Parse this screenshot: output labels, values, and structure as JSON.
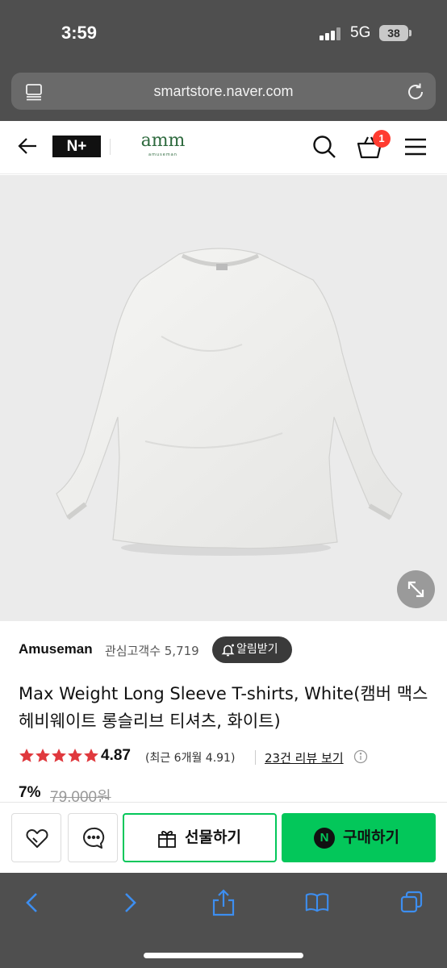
{
  "status_bar": {
    "time": "3:59",
    "network": "5G",
    "battery": "38"
  },
  "browser": {
    "url": "smartstore.naver.com"
  },
  "header": {
    "nplus_label": "N+",
    "brand_name": "amm",
    "brand_tagline": "amuseman",
    "cart_count": "1"
  },
  "seller": {
    "name": "Amuseman",
    "followers": "관심고객수 5,719",
    "alarm_label": "알림받기"
  },
  "product": {
    "title": "Max Weight Long Sleeve T-shirts, White(캠버 맥스헤비웨이트 롱슬리브 티셔츠, 화이트)",
    "image_alt": "white long sleeve t-shirt"
  },
  "rating": {
    "stars": 5,
    "value": "4.87",
    "recent": "(최근 6개월 4.91)",
    "review_link": "23건 리뷰 보기"
  },
  "price": {
    "discount": "7%",
    "original": "79,000원"
  },
  "actions": {
    "gift_label": "선물하기",
    "buy_label": "구매하기",
    "npay_mark": "N"
  },
  "colors": {
    "naver_green": "#03c75a",
    "star_red": "#e0393e",
    "chrome_gray": "#4f4f4f",
    "toolbar_blue": "#3d8ef0"
  },
  "icons": [
    "reader-icon",
    "reload-icon",
    "back-icon",
    "search-icon",
    "cart-icon",
    "menu-icon",
    "expand-icon",
    "bell-icon",
    "star-icon",
    "info-icon",
    "heart-icon",
    "chat-icon",
    "gift-icon",
    "npay-icon",
    "back-nav-icon",
    "forward-nav-icon",
    "share-icon",
    "bookmarks-icon",
    "tabs-icon"
  ]
}
